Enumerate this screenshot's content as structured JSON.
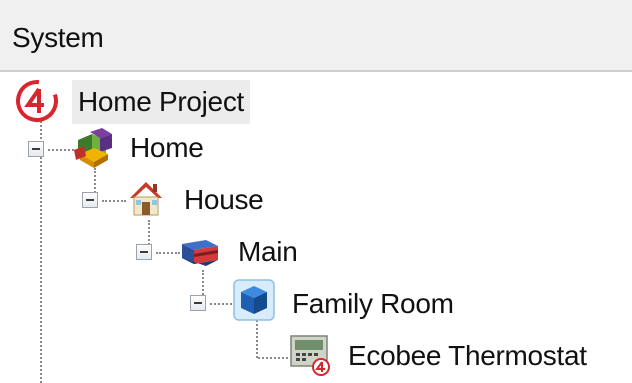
{
  "panel": {
    "title": "System"
  },
  "tree": {
    "root": {
      "label": "Home Project",
      "icon": "control4-logo-icon"
    },
    "nodes": [
      {
        "label": "Home",
        "icon": "home-cubes-icon",
        "depth": 1
      },
      {
        "label": "House",
        "icon": "house-icon",
        "depth": 2
      },
      {
        "label": "Main",
        "icon": "floor-icon",
        "depth": 3
      },
      {
        "label": "Family Room",
        "icon": "room-cube-icon",
        "depth": 4
      },
      {
        "label": "Ecobee Thermostat",
        "icon": "thermostat-device-icon",
        "depth": 5
      }
    ]
  },
  "colors": {
    "header_bg": "#f0f0f0",
    "selection_bg": "#ececec",
    "logo_red": "#d8262e",
    "connector": "#8a8a8a"
  }
}
